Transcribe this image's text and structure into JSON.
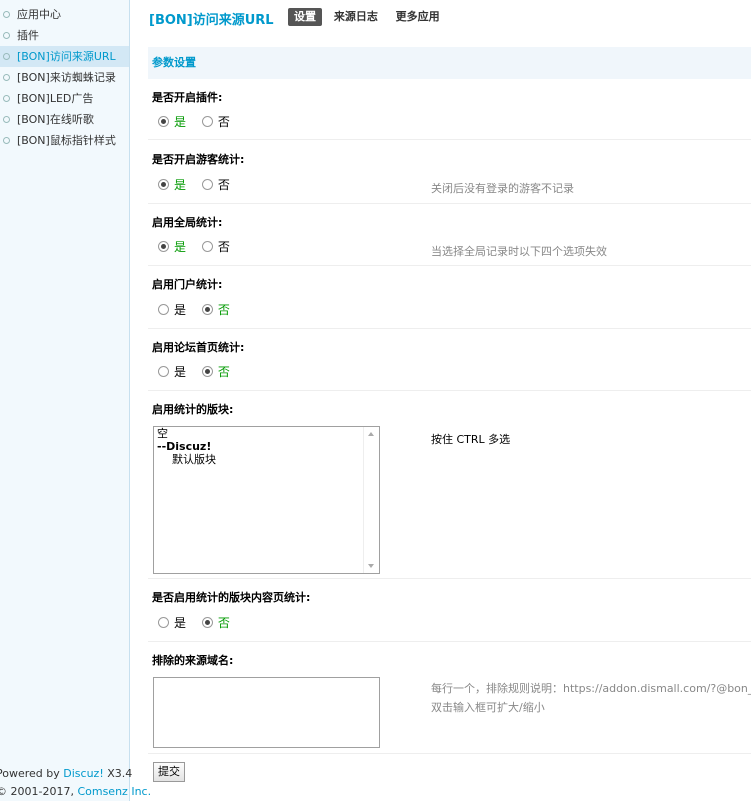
{
  "sidebar": {
    "items": [
      {
        "label": "应用中心"
      },
      {
        "label": "插件"
      },
      {
        "label": "[BON]访问来源URL"
      },
      {
        "label": "[BON]来访蜘蛛记录"
      },
      {
        "label": "[BON]LED广告"
      },
      {
        "label": "[BON]在线听歌"
      },
      {
        "label": "[BON]鼠标指针样式"
      }
    ],
    "footer": {
      "powered_prefix": "Powered by ",
      "powered_link": "Discuz!",
      "powered_version": " X3.4",
      "copyright_prefix": "© 2001-2017, ",
      "copyright_link": "Comsenz Inc."
    }
  },
  "header": {
    "title": "[BON]访问来源URL",
    "tabs": [
      {
        "label": "设置"
      },
      {
        "label": "来源日志"
      },
      {
        "label": "更多应用"
      }
    ]
  },
  "section_title": "参数设置",
  "settings": {
    "enable_plugin": {
      "label": "是否开启插件:",
      "yes": "是",
      "no": "否",
      "value": "是"
    },
    "guest_stats": {
      "label": "是否开启游客统计:",
      "yes": "是",
      "no": "否",
      "value": "是",
      "tip": "关闭后没有登录的游客不记录"
    },
    "global_stats": {
      "label": "启用全局统计:",
      "yes": "是",
      "no": "否",
      "value": "是",
      "tip": "当选择全局记录时以下四个选项失效"
    },
    "portal_stats": {
      "label": "启用门户统计:",
      "yes": "是",
      "no": "否",
      "value": "否"
    },
    "forum_index_stats": {
      "label": "启用论坛首页统计:",
      "yes": "是",
      "no": "否",
      "value": "否"
    },
    "forums": {
      "label": "启用统计的版块:",
      "tip": "按住 CTRL 多选",
      "options": [
        "空",
        "--Discuz!",
        "默认版块"
      ]
    },
    "forum_content_stats": {
      "label": "是否启用统计的版块内容页统计:",
      "yes": "是",
      "no": "否",
      "value": "否"
    },
    "exclude_domains": {
      "label": "排除的来源域名:",
      "tip1": "每行一个，排除规则说明：https://addon.dismall.com/?@bon_u",
      "tip2": "双击输入框可扩大/缩小"
    }
  },
  "submit_label": "提交"
}
